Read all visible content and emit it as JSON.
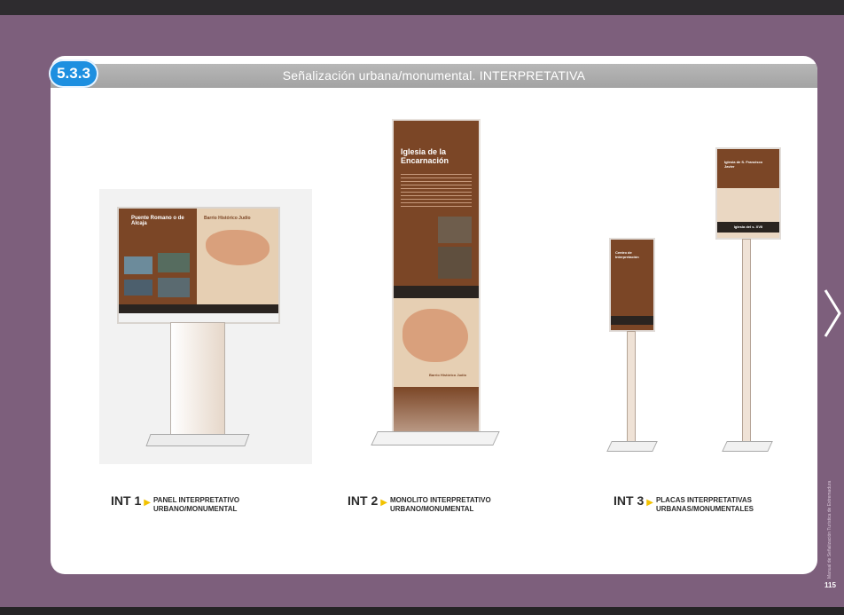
{
  "header": {
    "section_number": "5.3.3",
    "title": "Señalización urbana/monumental. INTERPRETATIVA"
  },
  "signs": [
    {
      "code": "INT 1",
      "line1": "PANEL INTERPRETATIVO",
      "line2": "URBANO/MONUMENTAL",
      "panel_title": "Puente Romano o de Alcaja",
      "map_title": "Barrio Histórico Judío"
    },
    {
      "code": "INT 2",
      "line1": "MONOLITO INTERPRETATIVO",
      "line2": "URBANO/MONUMENTAL",
      "panel_title": "Iglesia de la Encarnación",
      "map_title": "Barrio Histórico Judío"
    },
    {
      "code": "INT 3",
      "line1": "PLACAS INTERPRETATIVAS",
      "line2": "URBANAS/MONUMENTALES",
      "panel_title": "Centro de Interpretación",
      "panel_title_b": "Iglesia de S. Francisco Javier",
      "panel_footer_b": "Iglesia del s. XVII"
    }
  ],
  "side_text": "Manual de Señalización Turística de Extremadura",
  "page_number": "115",
  "colors": {
    "accent": "#1d8fe0",
    "sign_brown": "#7b4626",
    "background": "#7d5f7c",
    "arrow": "#f2c200"
  }
}
